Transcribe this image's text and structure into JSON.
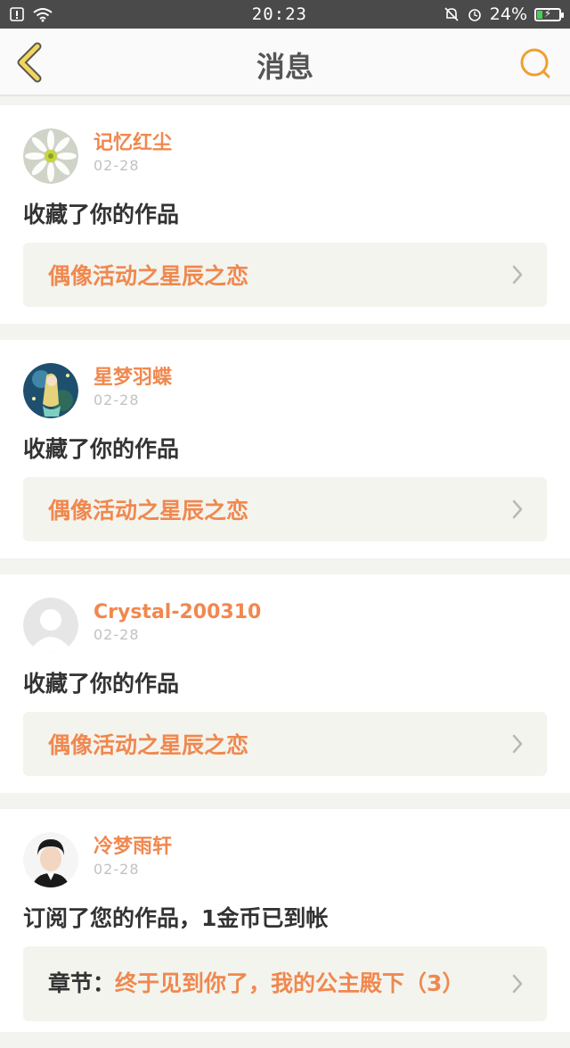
{
  "status_bar": {
    "time": "20:23",
    "battery_text": "24%",
    "battery_level": 0.24,
    "left_icons": [
      "sim-alert-icon",
      "wifi-icon"
    ],
    "right_icons": [
      "mute-bell-icon",
      "alarm-icon",
      "battery-icon"
    ]
  },
  "header": {
    "title": "消息",
    "back_icon": "chevron-left-icon",
    "search_icon": "search-icon",
    "accent": "#f0a030"
  },
  "colors": {
    "accent_orange": "#f0884f",
    "card_link_bg": "#f4f4ee",
    "page_bg": "#f3f3f0"
  },
  "messages": [
    {
      "username": "记忆红尘",
      "date": "02-28",
      "action": "收藏了你的作品",
      "work_title": "偶像活动之星辰之恋"
    },
    {
      "username": "星梦羽蝶",
      "date": "02-28",
      "action": "收藏了你的作品",
      "work_title": "偶像活动之星辰之恋"
    },
    {
      "username": "Crystal-200310",
      "date": "02-28",
      "action": "收藏了你的作品",
      "work_title": "偶像活动之星辰之恋"
    },
    {
      "username": "冷梦雨轩",
      "date": "02-28",
      "action": "订阅了您的作品，1金币已到帐",
      "chapter_prefix": "章节：",
      "chapter_title": "终于见到你了，我的公主殿下（3）"
    }
  ]
}
